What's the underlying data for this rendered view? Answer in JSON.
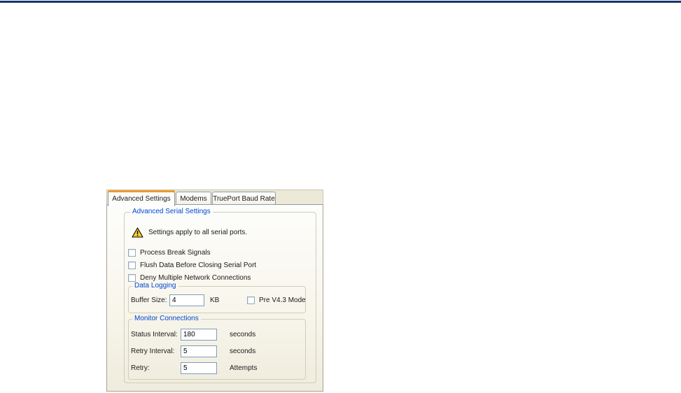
{
  "colors": {
    "top_bar": "#17366f",
    "tab_accent_orange": "#e68b2c",
    "dialog_beige": "#ece9d8",
    "group_label_blue": "#0046d5",
    "input_border": "#7f9db9"
  },
  "tabs": [
    {
      "label": "Advanced Settings",
      "selected": true
    },
    {
      "label": "Modems",
      "selected": false
    },
    {
      "label": "TruePort Baud Rate",
      "selected": false
    }
  ],
  "panel": {
    "group_title": "Advanced Serial Settings",
    "warning": {
      "icon": "warning-triangle-icon",
      "text": "Settings apply to all serial ports."
    },
    "checkboxes": [
      {
        "label": "Process Break Signals",
        "checked": false
      },
      {
        "label": "Flush Data Before Closing Serial Port",
        "checked": false
      },
      {
        "label": "Deny Multiple Network Connections",
        "checked": false
      }
    ],
    "data_logging": {
      "title": "Data Logging",
      "buffer_label": "Buffer Size:",
      "buffer_value": "4",
      "buffer_unit": "KB",
      "pre_mode": {
        "label": "Pre V4.3 Mode",
        "checked": false
      }
    },
    "monitor": {
      "title": "Monitor Connections",
      "rows": [
        {
          "label": "Status Interval:",
          "value": "180",
          "unit": "seconds"
        },
        {
          "label": "Retry Interval:",
          "value": "5",
          "unit": "seconds"
        },
        {
          "label": "Retry:",
          "value": "5",
          "unit": "Attempts"
        }
      ]
    }
  }
}
